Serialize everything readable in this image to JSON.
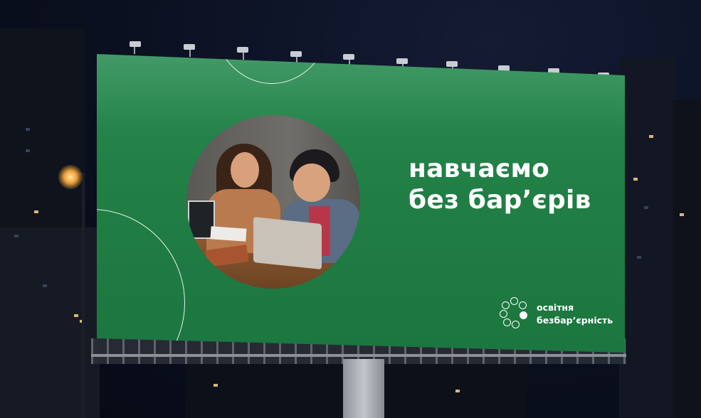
{
  "billboard": {
    "headline_line1": "навчаємо",
    "headline_line2": "без бар’єрів",
    "logo_line1": "освітня",
    "logo_line2": "безбар’єрність",
    "background_color": "#23844a",
    "text_color": "#ffffff"
  },
  "photo": {
    "icon": "two-people-laughing-at-laptops-photo"
  },
  "scene": {
    "setting": "night-city",
    "sky_color": "#0a0f1e"
  }
}
